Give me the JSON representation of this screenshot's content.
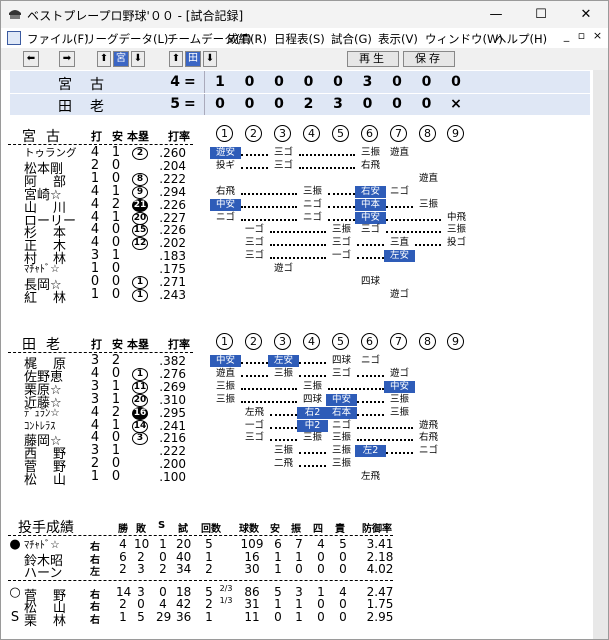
{
  "window": {
    "title": "ベストプレープロ野球'００ - [試合記録]",
    "minimize": "—",
    "maximize": "☐",
    "close": "✕"
  },
  "menu": [
    "ファイル(F)",
    "リーグデータ(L)",
    "チームデータ(T)",
    "成績(R)",
    "日程表(S)",
    "試合(G)",
    "表示(V)",
    "ウィンドウ(W)",
    "ヘルプ(H)"
  ],
  "mdi": {
    "minimize": "_",
    "restore": "▫",
    "close": "×"
  },
  "toolbar": {
    "left": "⬅",
    "right": "➡",
    "up1": "⬆",
    "team1": "宮",
    "down1": "⬇",
    "up2": "⬆",
    "team2": "田",
    "down2": "⬇",
    "replay": "再生",
    "save": "保存"
  },
  "scoreboard": [
    {
      "name": "宮古",
      "total": "4",
      "eq": "=",
      "innings": [
        "1",
        "0",
        "0",
        "0",
        "0",
        "3",
        "0",
        "0",
        "0"
      ]
    },
    {
      "name": "田老",
      "total": "5",
      "eq": "=",
      "innings": [
        "0",
        "0",
        "0",
        "2",
        "3",
        "0",
        "0",
        "0",
        "×"
      ]
    }
  ],
  "colheads": {
    "hit_a": "打",
    "hit_b": "安",
    "hr": "本塁",
    "avg": "打率"
  },
  "inning_labels": [
    "1",
    "2",
    "3",
    "4",
    "5",
    "6",
    "7",
    "8",
    "9"
  ],
  "team1": {
    "name": "宮古",
    "players": [
      {
        "name": "トゥラング",
        "ab": "4",
        "h": "1",
        "hr": "2",
        "hrf": false,
        "avg": ".260"
      },
      {
        "name": "松本剛",
        "ab": "2",
        "h": "0",
        "hr": "",
        "hrf": false,
        "avg": ".204"
      },
      {
        "name": "阿部",
        "ab": "1",
        "h": "0",
        "hr": "8",
        "hrf": false,
        "avg": ".222"
      },
      {
        "name": "宮崎☆",
        "ab": "4",
        "h": "1",
        "hr": "9",
        "hrf": false,
        "avg": ".294"
      },
      {
        "name": "山川",
        "ab": "4",
        "h": "2",
        "hr": "21",
        "hrf": true,
        "avg": ".226"
      },
      {
        "name": "ローリー",
        "ab": "4",
        "h": "1",
        "hr": "20",
        "hrf": false,
        "avg": ".227"
      },
      {
        "name": "杉本",
        "ab": "4",
        "h": "0",
        "hr": "15",
        "hrf": false,
        "avg": ".226"
      },
      {
        "name": "正木",
        "ab": "4",
        "h": "0",
        "hr": "12",
        "hrf": false,
        "avg": ".202"
      },
      {
        "name": "村林",
        "ab": "3",
        "h": "1",
        "hr": "",
        "hrf": false,
        "avg": ".183"
      },
      {
        "name": "ﾏﾁｬﾄﾞ☆",
        "ab": "1",
        "h": "0",
        "hr": "",
        "hrf": false,
        "avg": ".175"
      },
      {
        "name": "長岡☆",
        "ab": "0",
        "h": "0",
        "hr": "1",
        "hrf": false,
        "avg": ".271"
      },
      {
        "name": "紅林",
        "ab": "1",
        "h": "0",
        "hr": "1",
        "hrf": false,
        "avg": ".243"
      }
    ],
    "cells": [
      [
        {
          "c": 1,
          "t": "遊安",
          "h": true
        },
        {
          "c": 3,
          "t": "三ゴ"
        },
        {
          "c": 6,
          "t": "三振"
        },
        {
          "c": 7,
          "t": "遊直"
        }
      ],
      [
        {
          "c": 1,
          "t": "投ギ"
        },
        {
          "c": 3,
          "t": "三ゴ"
        },
        {
          "c": 6,
          "t": "右飛"
        }
      ],
      [
        {
          "c": 8,
          "t": "遊直"
        }
      ],
      [
        {
          "c": 1,
          "t": "右飛"
        },
        {
          "c": 4,
          "t": "三振"
        },
        {
          "c": 6,
          "t": "右安",
          "h": true
        },
        {
          "c": 7,
          "t": "ニゴ"
        }
      ],
      [
        {
          "c": 1,
          "t": "中安",
          "h": true
        },
        {
          "c": 4,
          "t": "ニゴ"
        },
        {
          "c": 6,
          "t": "中本",
          "h": true
        },
        {
          "c": 8,
          "t": "三振"
        }
      ],
      [
        {
          "c": 1,
          "t": "ニゴ"
        },
        {
          "c": 4,
          "t": "ニゴ"
        },
        {
          "c": 6,
          "t": "中安",
          "h": true
        },
        {
          "c": 9,
          "t": "中飛"
        }
      ],
      [
        {
          "c": 2,
          "t": "一ゴ"
        },
        {
          "c": 5,
          "t": "三振"
        },
        {
          "c": 6,
          "t": "三ゴ"
        },
        {
          "c": 9,
          "t": "三振"
        }
      ],
      [
        {
          "c": 2,
          "t": "三ゴ"
        },
        {
          "c": 5,
          "t": "三ゴ"
        },
        {
          "c": 7,
          "t": "三直"
        },
        {
          "c": 9,
          "t": "投ゴ"
        }
      ],
      [
        {
          "c": 2,
          "t": "三ゴ"
        },
        {
          "c": 5,
          "t": "一ゴ"
        },
        {
          "c": 7,
          "t": "左安",
          "h": true
        }
      ],
      [
        {
          "c": 3,
          "t": "遊ゴ"
        }
      ],
      [
        {
          "c": 6,
          "t": "四球"
        }
      ],
      [
        {
          "c": 7,
          "t": "遊ゴ"
        }
      ]
    ]
  },
  "team2": {
    "name": "田老",
    "players": [
      {
        "name": "梶原",
        "ab": "3",
        "h": "2",
        "hr": "",
        "hrf": false,
        "avg": ".382"
      },
      {
        "name": "佐野恵",
        "ab": "4",
        "h": "0",
        "hr": "1",
        "hrf": false,
        "avg": ".276"
      },
      {
        "name": "栗原☆",
        "ab": "3",
        "h": "1",
        "hr": "11",
        "hrf": false,
        "avg": ".269"
      },
      {
        "name": "近藤☆",
        "ab": "3",
        "h": "1",
        "hr": "20",
        "hrf": false,
        "avg": ".310"
      },
      {
        "name": "ﾃﾞｭﾗﾝ☆",
        "ab": "4",
        "h": "2",
        "hr": "16",
        "hrf": true,
        "avg": ".295"
      },
      {
        "name": "ｺﾝﾄﾚﾗｽ",
        "ab": "4",
        "h": "1",
        "hr": "14",
        "hrf": false,
        "avg": ".241"
      },
      {
        "name": "藤岡☆",
        "ab": "4",
        "h": "0",
        "hr": "3",
        "hrf": false,
        "avg": ".216"
      },
      {
        "name": "西野",
        "ab": "3",
        "h": "1",
        "hr": "",
        "hrf": false,
        "avg": ".222"
      },
      {
        "name": "菅野",
        "ab": "2",
        "h": "0",
        "hr": "",
        "hrf": false,
        "avg": ".200"
      },
      {
        "name": "松山",
        "ab": "1",
        "h": "0",
        "hr": "",
        "hrf": false,
        "avg": ".100"
      }
    ],
    "cells": [
      [
        {
          "c": 1,
          "t": "中安",
          "h": true
        },
        {
          "c": 3,
          "t": "左安",
          "h": true
        },
        {
          "c": 5,
          "t": "四球"
        },
        {
          "c": 6,
          "t": "ニゴ"
        }
      ],
      [
        {
          "c": 1,
          "t": "遊直"
        },
        {
          "c": 3,
          "t": "三振"
        },
        {
          "c": 5,
          "t": "三ゴ"
        },
        {
          "c": 7,
          "t": "遊ゴ"
        }
      ],
      [
        {
          "c": 1,
          "t": "三振"
        },
        {
          "c": 4,
          "t": "三振"
        },
        {
          "c": 7,
          "t": "中安",
          "h": true
        }
      ],
      [
        {
          "c": 1,
          "t": "三振"
        },
        {
          "c": 4,
          "t": "四球"
        },
        {
          "c": 5,
          "t": "中安",
          "h": true
        },
        {
          "c": 7,
          "t": "三振"
        }
      ],
      [
        {
          "c": 2,
          "t": "左飛"
        },
        {
          "c": 4,
          "t": "右2",
          "h": true
        },
        {
          "c": 5,
          "t": "右本",
          "h": true
        },
        {
          "c": 7,
          "t": "三振"
        }
      ],
      [
        {
          "c": 2,
          "t": "一ゴ"
        },
        {
          "c": 4,
          "t": "中2",
          "h": true
        },
        {
          "c": 5,
          "t": "ニゴ"
        },
        {
          "c": 8,
          "t": "遊飛"
        }
      ],
      [
        {
          "c": 2,
          "t": "三ゴ"
        },
        {
          "c": 4,
          "t": "三振"
        },
        {
          "c": 5,
          "t": "三振"
        },
        {
          "c": 8,
          "t": "右飛"
        }
      ],
      [
        {
          "c": 3,
          "t": "三振"
        },
        {
          "c": 5,
          "t": "三振"
        },
        {
          "c": 6,
          "t": "左2",
          "h": true
        },
        {
          "c": 8,
          "t": "ニゴ"
        }
      ],
      [
        {
          "c": 3,
          "t": "二飛"
        },
        {
          "c": 5,
          "t": "三振"
        }
      ],
      [
        {
          "c": 6,
          "t": "左飛"
        }
      ]
    ]
  },
  "pitching": {
    "title": "投手成績",
    "heads": [
      "勝",
      "敗",
      "S",
      "試",
      "回数",
      "球数",
      "安",
      "振",
      "四",
      "責",
      "防御率"
    ],
    "groups": [
      [
        {
          "mark": "●",
          "name": "ﾏﾁｬﾄﾞ☆",
          "hand": "右",
          "w": "4",
          "l": "10",
          "s": "1",
          "g": "20",
          "ip": "5",
          "ipf": "",
          "bp": "109",
          "h": "6",
          "k": "7",
          "bb": "4",
          "er": "5",
          "era": "3.41"
        },
        {
          "mark": "",
          "name": "鈴木昭",
          "hand": "右",
          "w": "6",
          "l": "2",
          "s": "0",
          "g": "40",
          "ip": "1",
          "ipf": "",
          "bp": "16",
          "h": "1",
          "k": "1",
          "bb": "0",
          "er": "0",
          "era": "2.18"
        },
        {
          "mark": "",
          "name": "ハーン",
          "hand": "左",
          "w": "2",
          "l": "3",
          "s": "2",
          "g": "34",
          "ip": "2",
          "ipf": "",
          "bp": "30",
          "h": "1",
          "k": "0",
          "bb": "0",
          "er": "0",
          "era": "4.02"
        }
      ],
      [
        {
          "mark": "○",
          "name": "菅野",
          "hand": "右",
          "w": "14",
          "l": "3",
          "s": "0",
          "g": "18",
          "ip": "5",
          "ipf": "2/3",
          "bp": "86",
          "h": "5",
          "k": "3",
          "bb": "1",
          "er": "4",
          "era": "2.47"
        },
        {
          "mark": "",
          "name": "松山",
          "hand": "右",
          "w": "2",
          "l": "0",
          "s": "4",
          "g": "42",
          "ip": "2",
          "ipf": "1/3",
          "bp": "31",
          "h": "1",
          "k": "1",
          "bb": "0",
          "er": "0",
          "era": "1.75"
        },
        {
          "mark": "S",
          "name": "栗林",
          "hand": "右",
          "w": "1",
          "l": "5",
          "s": "29",
          "g": "36",
          "ip": "1",
          "ipf": "",
          "bp": "11",
          "h": "0",
          "k": "1",
          "bb": "0",
          "er": "0",
          "era": "2.95"
        }
      ]
    ]
  }
}
